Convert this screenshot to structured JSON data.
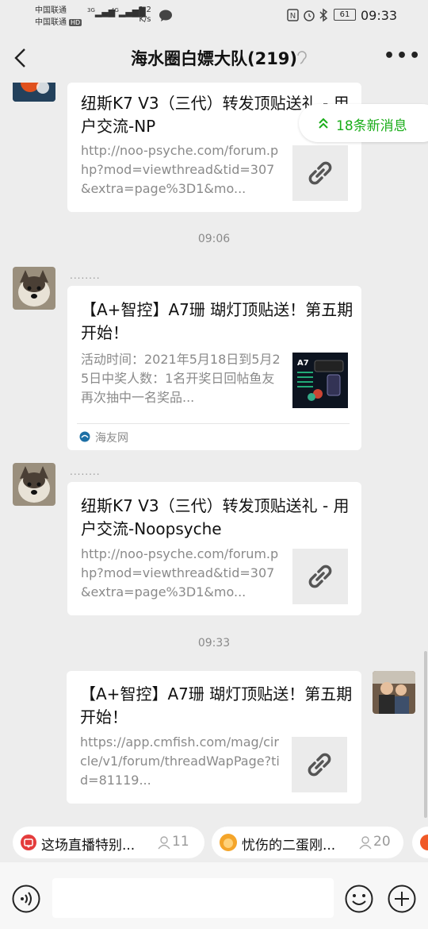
{
  "status_bar": {
    "carrier1": "中国联通",
    "carrier2": "中国联通",
    "hd": "HD",
    "net1": "3G",
    "net2": "4G",
    "speed_value": "1.2",
    "speed_unit": "K/s",
    "battery": "61",
    "time": "09:33"
  },
  "header": {
    "title": "海水圈白嫖大队(219)"
  },
  "new_messages": {
    "label": "18条新消息"
  },
  "messages": [
    {
      "title": "纽斯K7 V3（三代）转发顶贴送礼 - 用户交流-NP",
      "desc": "http://noo-psyche.com/forum.php?mod=viewthread&tid=307&extra=page%3D1&mo..."
    },
    {
      "time": "09:06",
      "sender": "........",
      "title": "【A+智控】A7珊 瑚灯顶贴送！第五期开始！",
      "desc": "活动时间：2021年5月18日到5月25日中奖人数：1名开奖日回帖鱼友再次抽中一名奖品...",
      "source": "海友网"
    },
    {
      "sender": "........",
      "title": "纽斯K7 V3（三代）转发顶贴送礼 - 用户交流-Noopsyche",
      "desc": "http://noo-psyche.com/forum.php?mod=viewthread&tid=307&extra=page%3D1&mo..."
    },
    {
      "time": "09:33",
      "title": "【A+智控】A7珊 瑚灯顶贴送！第五期开始！",
      "desc": "https://app.cmfish.com/mag/circle/v1/forum/threadWapPage?tid=81119..."
    }
  ],
  "live_bar": [
    {
      "label": "这场直播特别...",
      "count": "11"
    },
    {
      "label": "忧伤的二蛋刚...",
      "count": "20"
    }
  ],
  "colors": {
    "accent_green": "#1aad19",
    "bg": "#ededed"
  }
}
